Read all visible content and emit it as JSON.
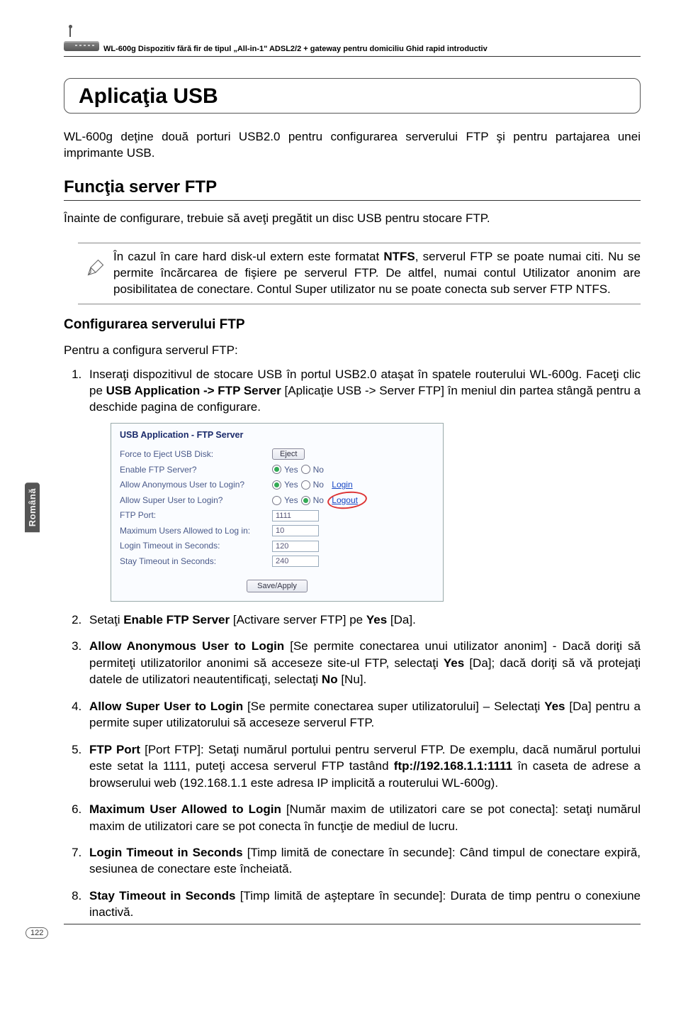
{
  "header": {
    "text": "WL-600g Dispozitiv fără fir de tipul „All-in-1\" ADSL2/2 + gateway pentru domiciliu Ghid rapid introductiv"
  },
  "sideTab": "Română",
  "title": "Aplicaţia USB",
  "intro": "WL-600g deţine două porturi USB2.0 pentru configurarea serverului FTP şi pentru partajarea unei imprimante USB.",
  "h2": "Funcţia server FTP",
  "h2_sub": "Înainte de configurare, trebuie să aveţi pregătit un disc USB pentru stocare FTP.",
  "note": {
    "pre": "În cazul în care hard disk-ul extern este formatat ",
    "bold": "NTFS",
    "post": ", serverul FTP se poate numai citi. Nu se permite încărcarea de fişiere pe serverul FTP. De altfel, numai contul Utilizator anonim are posibilitatea de conectare. Contul Super utilizator nu se poate conecta sub server FTP NTFS."
  },
  "h3": "Configurarea serverului FTP",
  "ol_intro": "Pentru a configura serverul FTP:",
  "step1": {
    "pre": "Inseraţi dispozitivul de stocare USB în portul USB2.0 ataşat în spatele routerului WL-600g. Faceţi clic pe ",
    "bold": "USB Application -> FTP Server",
    "mid": " [Aplicaţie USB -> Server FTP] în meniul din partea stângă pentru a deschide pagina de configurare."
  },
  "screenshot": {
    "title": "USB Application - FTP Server",
    "rows": {
      "force": "Force to Eject USB Disk:",
      "enable": "Enable FTP Server?",
      "anon": "Allow Anonymous User to Login?",
      "super": "Allow Super User to Login?",
      "port": "FTP Port:",
      "max": "Maximum Users Allowed to Log in:",
      "loginTo": "Login Timeout in Seconds:",
      "stayTo": "Stay Timeout in Seconds:"
    },
    "values": {
      "eject": "Eject",
      "yes": "Yes",
      "no": "No",
      "login": "Login",
      "logout": "Logout",
      "port": "1111",
      "max": "10",
      "loginTo": "120",
      "stayTo": "240",
      "save": "Save/Apply"
    }
  },
  "step2": {
    "pre": "Setaţi ",
    "b1": "Enable FTP Server",
    "mid": " [Activare server FTP] pe ",
    "b2": "Yes",
    "post": " [Da]."
  },
  "step3": {
    "b1": "Allow Anonymous User to Login",
    "mid1": " [Se permite conectarea unui utilizator anonim] - Dacă doriţi să permiteţi utilizatorilor anonimi să acceseze site-ul FTP, selectaţi ",
    "b2": "Yes",
    "mid2": " [Da]; dacă doriţi să vă protejaţi datele de utilizatori neautentificaţi, selectaţi ",
    "b3": "No",
    "post": " [Nu]."
  },
  "step4": {
    "b1": "Allow Super User to Login",
    "mid": " [Se permite conectarea super utilizatorului] – Selectaţi ",
    "b2": "Yes",
    "post": " [Da] pentru a permite super utilizatorului să acceseze serverul FTP."
  },
  "step5": {
    "b1": "FTP Port",
    "mid1": " [Port FTP]: Setaţi numărul portului pentru serverul FTP. De exemplu, dacă numărul portului este setat la 1111, puteţi accesa serverul FTP tastând ",
    "b2": "ftp://192.168.1.1:1111",
    "post": " în caseta de adrese a browserului web (192.168.1.1 este adresa IP implicită a routerului WL-600g)."
  },
  "step6": {
    "b1": "Maximum User Allowed to Login",
    "post": " [Număr maxim de utilizatori care se pot conecta]: setaţi numărul maxim de utilizatori care se pot conecta în funcţie de mediul de lucru."
  },
  "step7": {
    "b1": "Login Timeout in Seconds",
    "post": " [Timp limită de conectare în secunde]: Când timpul de conectare expiră, sesiunea de conectare este încheiată."
  },
  "step8": {
    "b1": "Stay Timeout in Seconds",
    "post": " [Timp limită de aşteptare în secunde]: Durata de timp pentru o conexiune inactivă."
  },
  "pageNumber": "122"
}
